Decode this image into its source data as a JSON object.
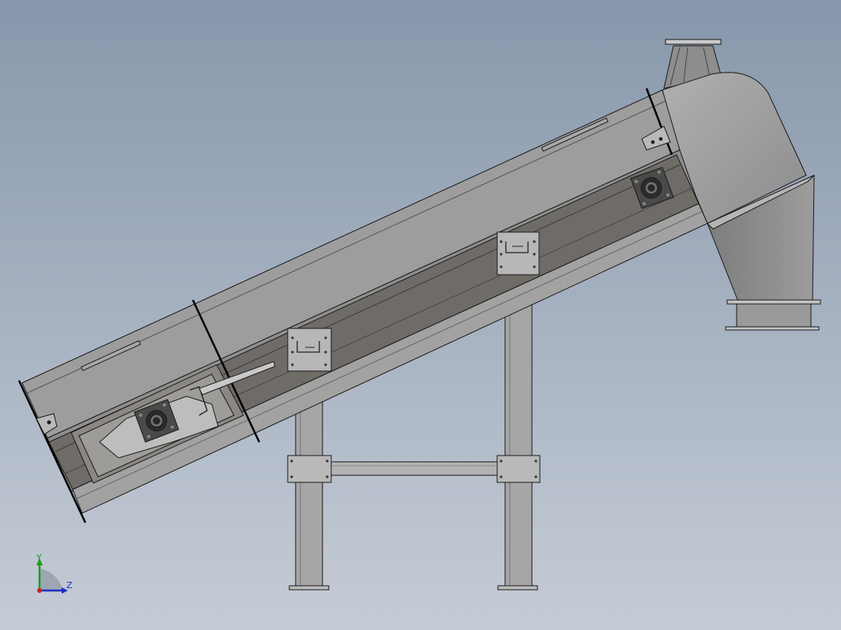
{
  "triad": {
    "y_label": "Y",
    "z_label": "Z",
    "colors": {
      "y": "#1a9e1a",
      "z": "#1e2fbf",
      "origin": "#cc2222"
    }
  },
  "colors": {
    "background_top": "#8797ab",
    "background_bottom": "#c6ccd6",
    "housing": "#9a9a9a",
    "housing_shade": "#8a8a8a",
    "trough": "#6e6b66",
    "steel": "#a9a9a9",
    "edge": "#1a1a1a"
  }
}
